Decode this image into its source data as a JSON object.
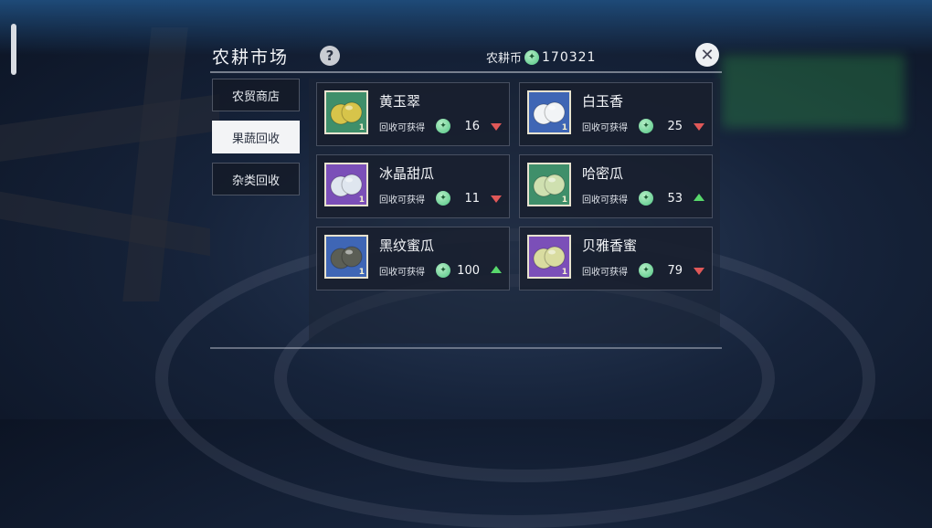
{
  "header": {
    "title": "农耕市场",
    "help_label": "?",
    "coin_label": "农耕币",
    "coin_value": "170321"
  },
  "sidebar": {
    "tabs": [
      {
        "label": "农贸商店",
        "active": false
      },
      {
        "label": "果蔬回收",
        "active": true
      },
      {
        "label": "杂类回收",
        "active": false
      }
    ]
  },
  "items": [
    {
      "name": "黄玉翠",
      "recycle_label": "回收可获得",
      "price": "16",
      "trend": "down",
      "bg": "#3f8f6a",
      "fruit": "#d7c44a",
      "tier": "1"
    },
    {
      "name": "白玉香",
      "recycle_label": "回收可获得",
      "price": "25",
      "trend": "down",
      "bg": "#3f66b5",
      "fruit": "#f2f4f6",
      "tier": "1"
    },
    {
      "name": "冰晶甜瓜",
      "recycle_label": "回收可获得",
      "price": "11",
      "trend": "down",
      "bg": "#7b4fb8",
      "fruit": "#dfe6ef",
      "tier": "1"
    },
    {
      "name": "哈密瓜",
      "recycle_label": "回收可获得",
      "price": "53",
      "trend": "up",
      "bg": "#3f8f6a",
      "fruit": "#cfe0b0",
      "tier": "1"
    },
    {
      "name": "黑纹蜜瓜",
      "recycle_label": "回收可获得",
      "price": "100",
      "trend": "up",
      "bg": "#3f66b5",
      "fruit": "#5b5e55",
      "tier": "1"
    },
    {
      "name": "贝雅香蜜",
      "recycle_label": "回收可获得",
      "price": "79",
      "trend": "down",
      "bg": "#7b4fb8",
      "fruit": "#d9dca0",
      "tier": "1"
    }
  ],
  "colors": {
    "trend_up": "#58d86c",
    "trend_down": "#e05858",
    "coin": "#4fc483"
  }
}
